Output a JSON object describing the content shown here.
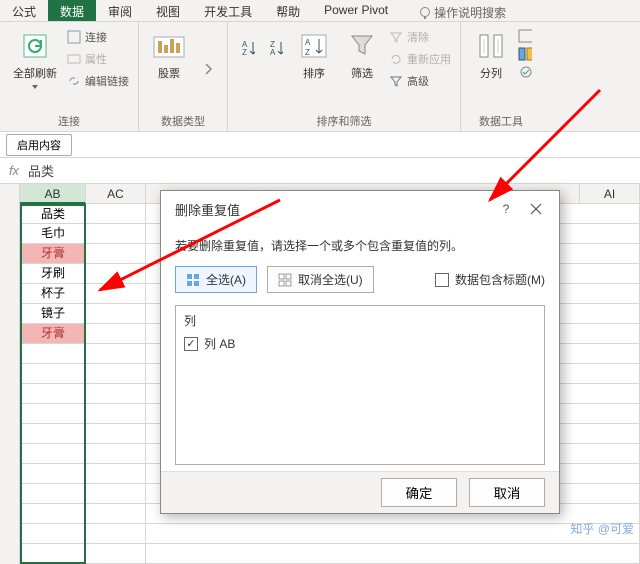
{
  "tabs": {
    "gs": "公式",
    "sj": "数据",
    "sy": "审阅",
    "st": "视图",
    "kf": "开发工具",
    "bz": "帮助",
    "pp": "Power Pivot",
    "search": "操作说明搜索"
  },
  "ribbon": {
    "g1": {
      "label": "连接",
      "big": "全部刷新",
      "i1": "连接",
      "i2": "属性",
      "i3": "编辑链接"
    },
    "g2": {
      "label": "数据类型",
      "big": "股票"
    },
    "g3": {
      "label": "排序和筛选",
      "sort": "排序",
      "filter": "筛选",
      "clear": "清除",
      "reapply": "重新应用",
      "adv": "高级"
    },
    "g4": {
      "label": "数据工具",
      "split": "分列"
    }
  },
  "msgbar": {
    "btn": "启用内容"
  },
  "fx": {
    "label": "fx",
    "value": "品类"
  },
  "cols": {
    "ab": "AB",
    "ac": "AC",
    "ai": "AI"
  },
  "data_rows": [
    "品类",
    "毛巾",
    "牙膏",
    "牙刷",
    "杯子",
    "镜子",
    "牙膏"
  ],
  "dup_indices": [
    2,
    6
  ],
  "dialog": {
    "title": "删除重复值",
    "msg": "若要删除重复值，请选择一个或多个包含重复值的列。",
    "selectAll": "全选(A)",
    "unselectAll": "取消全选(U)",
    "hasHeader": "数据包含标题(M)",
    "listTitle": "列",
    "colItem": "列 AB",
    "ok": "确定",
    "cancel": "取消"
  },
  "watermark": "知乎 @可爱"
}
